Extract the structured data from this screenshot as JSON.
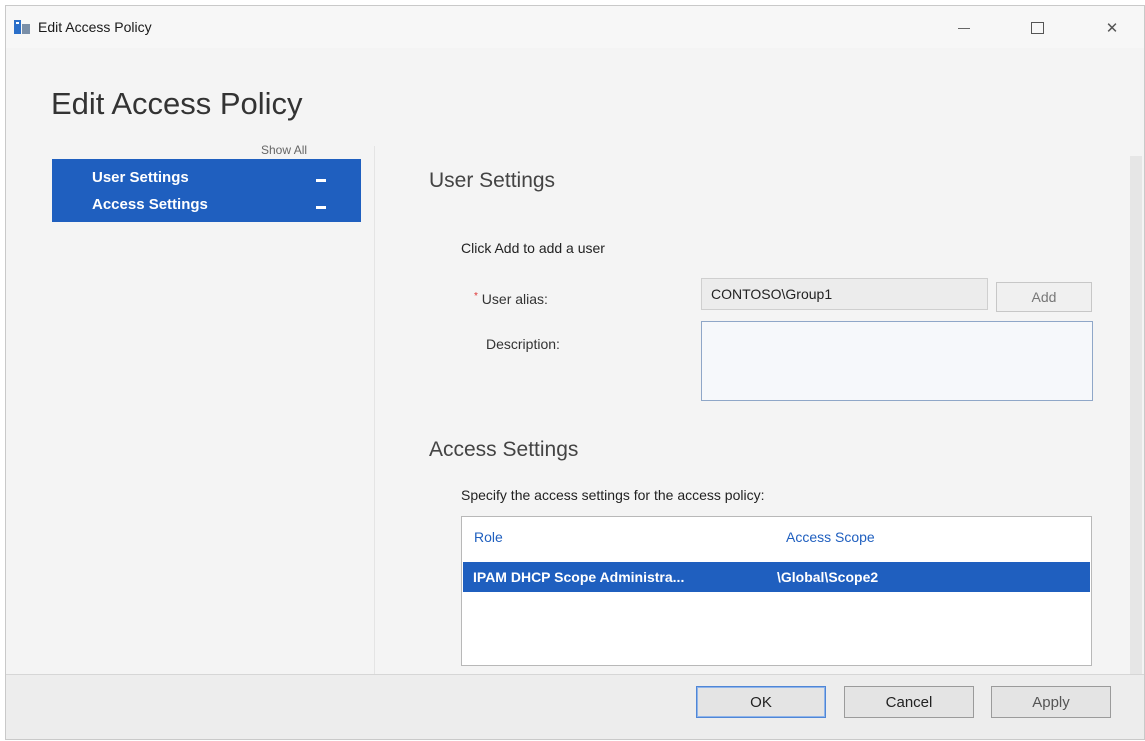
{
  "window": {
    "title": "Edit Access Policy",
    "controls": {
      "minimize": "—",
      "maximize": "☐",
      "close": "✕"
    }
  },
  "page": {
    "title": "Edit Access Policy"
  },
  "nav": {
    "show_all": "Show All",
    "items": [
      {
        "label": "User Settings",
        "state": "—"
      },
      {
        "label": "Access Settings",
        "state": "—"
      }
    ]
  },
  "user_settings": {
    "title": "User Settings",
    "hint": "Click Add to add a user",
    "alias_label": "User alias:",
    "alias_required_mark": "*",
    "alias_value": "CONTOSO\\Group1",
    "add_button": "Add",
    "description_label": "Description:",
    "description_value": ""
  },
  "access_settings": {
    "title": "Access Settings",
    "instruction": "Specify the access settings for the access policy:",
    "columns": [
      "Role",
      "Access Scope"
    ],
    "rows": [
      {
        "role": "IPAM DHCP Scope Administra...",
        "scope": "\\Global\\Scope2",
        "selected": true
      }
    ]
  },
  "footer": {
    "ok": "OK",
    "cancel": "Cancel",
    "apply": "Apply"
  },
  "colors": {
    "accent": "#1f5fbf",
    "window_bg": "#f4f4f4"
  },
  "icons": [
    "app-icon",
    "minimize-icon",
    "maximize-icon",
    "close-icon"
  ]
}
